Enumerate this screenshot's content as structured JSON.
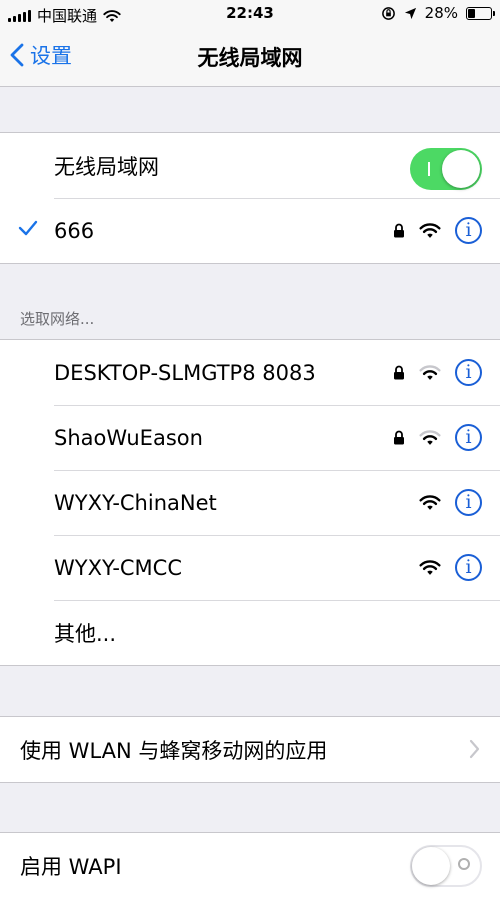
{
  "status_bar": {
    "carrier": "中国联通",
    "time": "22:43",
    "battery": "28%",
    "battery_level": 0.28
  },
  "nav": {
    "back_label": "设置",
    "title": "无线局域网"
  },
  "wifi_toggle": {
    "label": "无线局域网",
    "on": true
  },
  "connected": {
    "name": "666"
  },
  "section": {
    "choose_network": "选取网络..."
  },
  "networks": [
    {
      "name": "DESKTOP-SLMGTP8 8083",
      "locked": true
    },
    {
      "name": "ShaoWuEason",
      "locked": true
    },
    {
      "name": "WYXY-ChinaNet",
      "locked": false
    },
    {
      "name": "WYXY-CMCC",
      "locked": false
    }
  ],
  "other_label": "其他...",
  "apps_row": {
    "label": "使用 WLAN 与蜂窝移动网的应用"
  },
  "wapi_row": {
    "label": "启用 WAPI",
    "on": false
  },
  "colors": {
    "accent": "#1a73e8",
    "toggle_on": "#4cd964",
    "background": "#efeff4"
  }
}
